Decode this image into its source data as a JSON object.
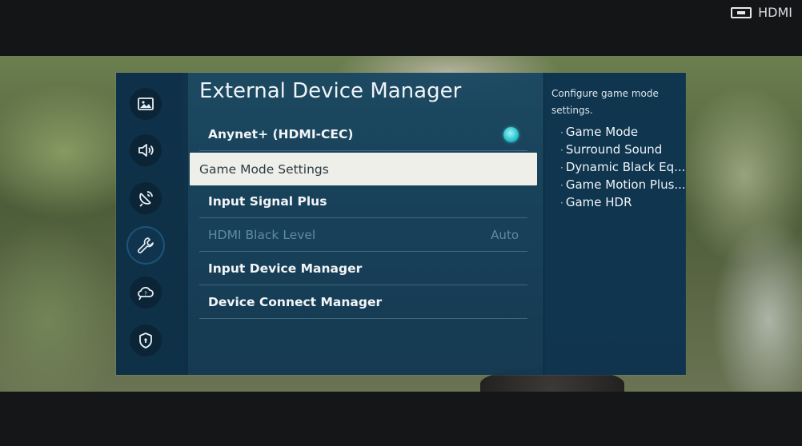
{
  "source": {
    "label": "HDMI",
    "icon": "hdmi-port-icon"
  },
  "sidebar": {
    "items": [
      {
        "name": "picture",
        "icon": "picture-icon",
        "active": false
      },
      {
        "name": "sound",
        "icon": "sound-icon",
        "active": false
      },
      {
        "name": "broadcasting",
        "icon": "broadcast-icon",
        "active": false
      },
      {
        "name": "general",
        "icon": "wrench-icon",
        "active": true
      },
      {
        "name": "support",
        "icon": "support-cloud-icon",
        "active": false
      },
      {
        "name": "privacy",
        "icon": "shield-icon",
        "active": false
      }
    ]
  },
  "main": {
    "title": "External Device Manager",
    "items": [
      {
        "label": "Anynet+ (HDMI-CEC)",
        "value": "",
        "toggle": true,
        "state": "on"
      },
      {
        "label": "Game Mode Settings",
        "value": "",
        "selected": true
      },
      {
        "label": "Input Signal Plus",
        "value": ""
      },
      {
        "label": "HDMI Black Level",
        "value": "Auto",
        "disabled": true
      },
      {
        "label": "Input Device Manager",
        "value": ""
      },
      {
        "label": "Device Connect Manager",
        "value": ""
      }
    ]
  },
  "info": {
    "description": "Configure game mode settings.",
    "list": [
      "Game Mode",
      "Surround Sound",
      "Dynamic Black Eq...",
      "Game Motion Plus...",
      "Game HDR"
    ]
  },
  "colors": {
    "toggle_on": "#27c2cc",
    "panel_bg": "#184662",
    "selected_bg": "#eeefe9"
  }
}
